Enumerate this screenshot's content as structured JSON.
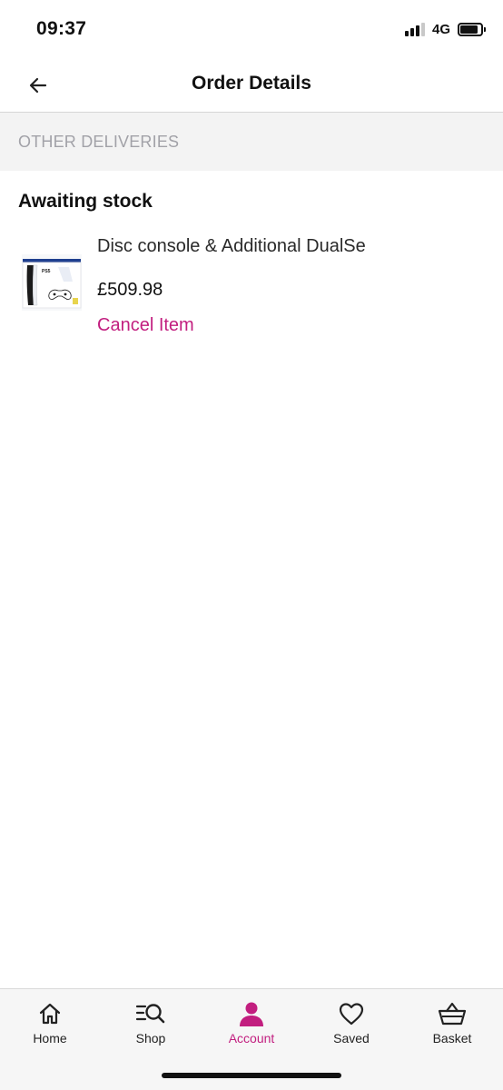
{
  "status_bar": {
    "time": "09:37",
    "network": "4G",
    "battery_level": 0.85
  },
  "header": {
    "title": "Order Details",
    "back_icon": "arrow-left-icon"
  },
  "section": {
    "label": "OTHER DELIVERIES"
  },
  "delivery": {
    "status": "Awaiting stock",
    "item": {
      "name": "Disc console & Additional DualSe",
      "price": "£509.98",
      "cancel_label": "Cancel Item",
      "image_icon": "game-console-box-image"
    }
  },
  "bottom_nav": {
    "items": [
      {
        "label": "Home",
        "icon": "home-icon"
      },
      {
        "label": "Shop",
        "icon": "search-list-icon"
      },
      {
        "label": "Account",
        "icon": "person-icon"
      },
      {
        "label": "Saved",
        "icon": "heart-icon"
      },
      {
        "label": "Basket",
        "icon": "basket-icon"
      }
    ],
    "active": "Account"
  },
  "colors": {
    "accent": "#c21e7f",
    "section_bg": "#f3f3f3",
    "section_text": "#a2a2a8",
    "nav_bg": "#f6f6f6"
  }
}
